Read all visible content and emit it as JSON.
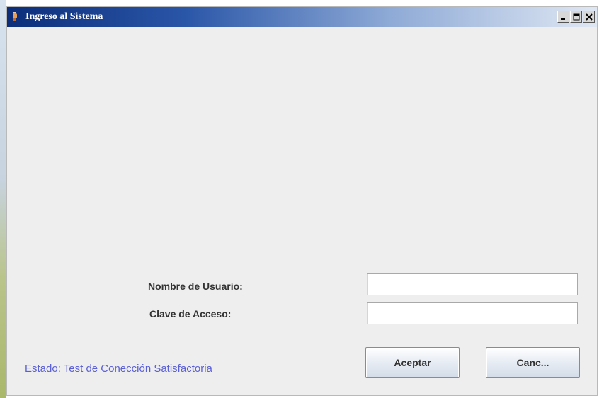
{
  "window": {
    "title": "Ingreso al Sistema",
    "controls": [
      "minimize-icon",
      "maximize-icon",
      "close-icon"
    ]
  },
  "form": {
    "username_label": "Nombre de Usuario:",
    "username_value": "",
    "password_label": "Clave de Acceso:",
    "password_value": ""
  },
  "status": {
    "text": "Estado: Test de Conección Satisfactoria",
    "color": "#5a5fd6"
  },
  "buttons": {
    "accept_label": "Aceptar",
    "cancel_label": "Canc..."
  },
  "colors": {
    "titlebar_start": "#0c2e7a",
    "titlebar_end": "#dfe7f3",
    "window_bg": "#eeeeee"
  }
}
